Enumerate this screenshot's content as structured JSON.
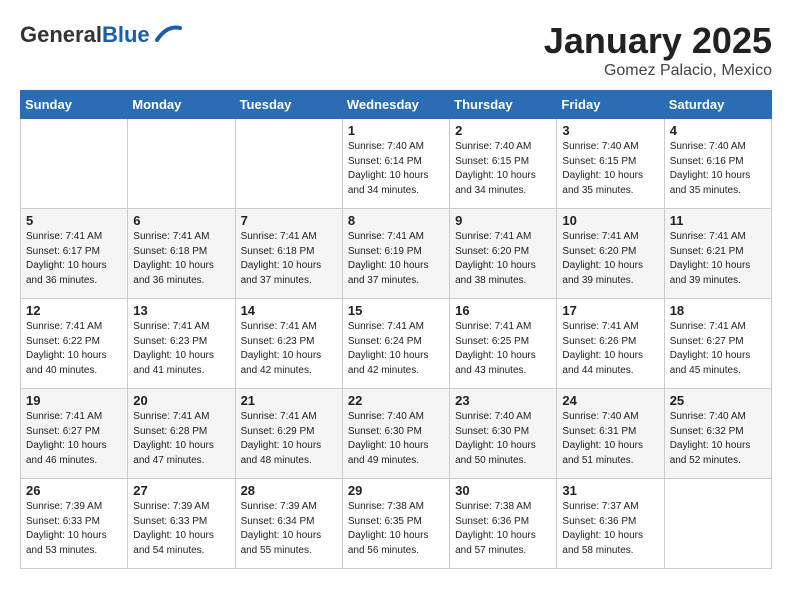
{
  "header": {
    "logo_general": "General",
    "logo_blue": "Blue",
    "title": "January 2025",
    "subtitle": "Gomez Palacio, Mexico"
  },
  "weekdays": [
    "Sunday",
    "Monday",
    "Tuesday",
    "Wednesday",
    "Thursday",
    "Friday",
    "Saturday"
  ],
  "weeks": [
    [
      {
        "day": "",
        "sunrise": "",
        "sunset": "",
        "daylight": ""
      },
      {
        "day": "",
        "sunrise": "",
        "sunset": "",
        "daylight": ""
      },
      {
        "day": "",
        "sunrise": "",
        "sunset": "",
        "daylight": ""
      },
      {
        "day": "1",
        "sunrise": "Sunrise: 7:40 AM",
        "sunset": "Sunset: 6:14 PM",
        "daylight": "Daylight: 10 hours and 34 minutes."
      },
      {
        "day": "2",
        "sunrise": "Sunrise: 7:40 AM",
        "sunset": "Sunset: 6:15 PM",
        "daylight": "Daylight: 10 hours and 34 minutes."
      },
      {
        "day": "3",
        "sunrise": "Sunrise: 7:40 AM",
        "sunset": "Sunset: 6:15 PM",
        "daylight": "Daylight: 10 hours and 35 minutes."
      },
      {
        "day": "4",
        "sunrise": "Sunrise: 7:40 AM",
        "sunset": "Sunset: 6:16 PM",
        "daylight": "Daylight: 10 hours and 35 minutes."
      }
    ],
    [
      {
        "day": "5",
        "sunrise": "Sunrise: 7:41 AM",
        "sunset": "Sunset: 6:17 PM",
        "daylight": "Daylight: 10 hours and 36 minutes."
      },
      {
        "day": "6",
        "sunrise": "Sunrise: 7:41 AM",
        "sunset": "Sunset: 6:18 PM",
        "daylight": "Daylight: 10 hours and 36 minutes."
      },
      {
        "day": "7",
        "sunrise": "Sunrise: 7:41 AM",
        "sunset": "Sunset: 6:18 PM",
        "daylight": "Daylight: 10 hours and 37 minutes."
      },
      {
        "day": "8",
        "sunrise": "Sunrise: 7:41 AM",
        "sunset": "Sunset: 6:19 PM",
        "daylight": "Daylight: 10 hours and 37 minutes."
      },
      {
        "day": "9",
        "sunrise": "Sunrise: 7:41 AM",
        "sunset": "Sunset: 6:20 PM",
        "daylight": "Daylight: 10 hours and 38 minutes."
      },
      {
        "day": "10",
        "sunrise": "Sunrise: 7:41 AM",
        "sunset": "Sunset: 6:20 PM",
        "daylight": "Daylight: 10 hours and 39 minutes."
      },
      {
        "day": "11",
        "sunrise": "Sunrise: 7:41 AM",
        "sunset": "Sunset: 6:21 PM",
        "daylight": "Daylight: 10 hours and 39 minutes."
      }
    ],
    [
      {
        "day": "12",
        "sunrise": "Sunrise: 7:41 AM",
        "sunset": "Sunset: 6:22 PM",
        "daylight": "Daylight: 10 hours and 40 minutes."
      },
      {
        "day": "13",
        "sunrise": "Sunrise: 7:41 AM",
        "sunset": "Sunset: 6:23 PM",
        "daylight": "Daylight: 10 hours and 41 minutes."
      },
      {
        "day": "14",
        "sunrise": "Sunrise: 7:41 AM",
        "sunset": "Sunset: 6:23 PM",
        "daylight": "Daylight: 10 hours and 42 minutes."
      },
      {
        "day": "15",
        "sunrise": "Sunrise: 7:41 AM",
        "sunset": "Sunset: 6:24 PM",
        "daylight": "Daylight: 10 hours and 42 minutes."
      },
      {
        "day": "16",
        "sunrise": "Sunrise: 7:41 AM",
        "sunset": "Sunset: 6:25 PM",
        "daylight": "Daylight: 10 hours and 43 minutes."
      },
      {
        "day": "17",
        "sunrise": "Sunrise: 7:41 AM",
        "sunset": "Sunset: 6:26 PM",
        "daylight": "Daylight: 10 hours and 44 minutes."
      },
      {
        "day": "18",
        "sunrise": "Sunrise: 7:41 AM",
        "sunset": "Sunset: 6:27 PM",
        "daylight": "Daylight: 10 hours and 45 minutes."
      }
    ],
    [
      {
        "day": "19",
        "sunrise": "Sunrise: 7:41 AM",
        "sunset": "Sunset: 6:27 PM",
        "daylight": "Daylight: 10 hours and 46 minutes."
      },
      {
        "day": "20",
        "sunrise": "Sunrise: 7:41 AM",
        "sunset": "Sunset: 6:28 PM",
        "daylight": "Daylight: 10 hours and 47 minutes."
      },
      {
        "day": "21",
        "sunrise": "Sunrise: 7:41 AM",
        "sunset": "Sunset: 6:29 PM",
        "daylight": "Daylight: 10 hours and 48 minutes."
      },
      {
        "day": "22",
        "sunrise": "Sunrise: 7:40 AM",
        "sunset": "Sunset: 6:30 PM",
        "daylight": "Daylight: 10 hours and 49 minutes."
      },
      {
        "day": "23",
        "sunrise": "Sunrise: 7:40 AM",
        "sunset": "Sunset: 6:30 PM",
        "daylight": "Daylight: 10 hours and 50 minutes."
      },
      {
        "day": "24",
        "sunrise": "Sunrise: 7:40 AM",
        "sunset": "Sunset: 6:31 PM",
        "daylight": "Daylight: 10 hours and 51 minutes."
      },
      {
        "day": "25",
        "sunrise": "Sunrise: 7:40 AM",
        "sunset": "Sunset: 6:32 PM",
        "daylight": "Daylight: 10 hours and 52 minutes."
      }
    ],
    [
      {
        "day": "26",
        "sunrise": "Sunrise: 7:39 AM",
        "sunset": "Sunset: 6:33 PM",
        "daylight": "Daylight: 10 hours and 53 minutes."
      },
      {
        "day": "27",
        "sunrise": "Sunrise: 7:39 AM",
        "sunset": "Sunset: 6:33 PM",
        "daylight": "Daylight: 10 hours and 54 minutes."
      },
      {
        "day": "28",
        "sunrise": "Sunrise: 7:39 AM",
        "sunset": "Sunset: 6:34 PM",
        "daylight": "Daylight: 10 hours and 55 minutes."
      },
      {
        "day": "29",
        "sunrise": "Sunrise: 7:38 AM",
        "sunset": "Sunset: 6:35 PM",
        "daylight": "Daylight: 10 hours and 56 minutes."
      },
      {
        "day": "30",
        "sunrise": "Sunrise: 7:38 AM",
        "sunset": "Sunset: 6:36 PM",
        "daylight": "Daylight: 10 hours and 57 minutes."
      },
      {
        "day": "31",
        "sunrise": "Sunrise: 7:37 AM",
        "sunset": "Sunset: 6:36 PM",
        "daylight": "Daylight: 10 hours and 58 minutes."
      },
      {
        "day": "",
        "sunrise": "",
        "sunset": "",
        "daylight": ""
      }
    ]
  ]
}
